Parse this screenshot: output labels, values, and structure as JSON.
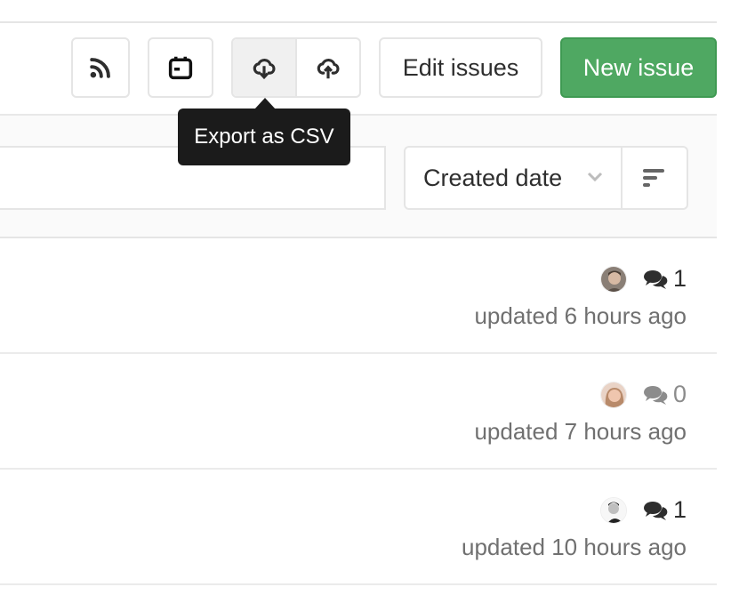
{
  "toolbar": {
    "rss_icon": "rss-icon",
    "calendar_icon": "calendar-icon",
    "export_icon": "cloud-download-icon",
    "import_icon": "cloud-upload-icon",
    "edit_issues_label": "Edit issues",
    "new_issue_label": "New issue"
  },
  "tooltip": {
    "text": "Export as CSV"
  },
  "filter": {
    "search_value": "",
    "sort_selected": "Created date",
    "sort_direction_icon": "sort-lowest-icon"
  },
  "issues": [
    {
      "avatar": "user-avatar-1",
      "comment_count": "1",
      "updated": "updated 6 hours ago"
    },
    {
      "avatar": "user-avatar-2",
      "comment_count": "0",
      "updated": "updated 7 hours ago"
    },
    {
      "avatar": "user-avatar-3",
      "comment_count": "1",
      "updated": "updated 10 hours ago"
    }
  ],
  "colors": {
    "primary_green": "#4fa862",
    "tooltip_bg": "#1b1b1b",
    "border": "#e5e5e5"
  }
}
